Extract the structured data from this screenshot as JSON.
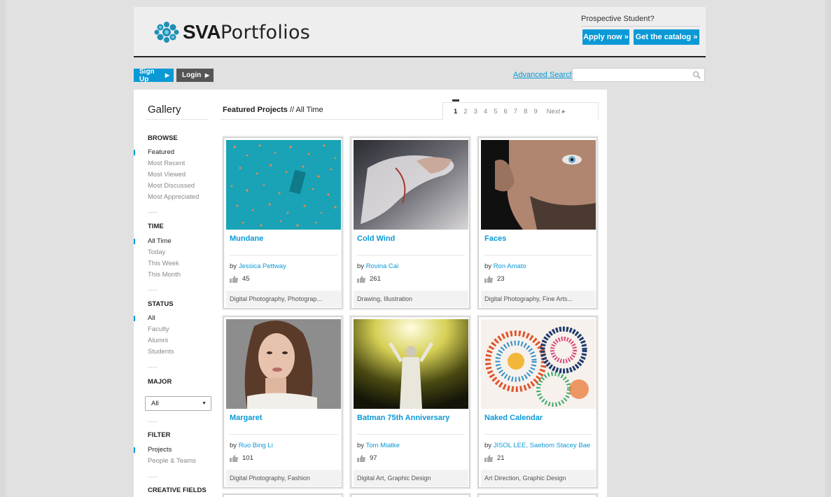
{
  "header": {
    "logo_bold": "SVA",
    "logo_rest": "Portfolios",
    "prospective": "Prospective Student?",
    "apply_label": "Apply now »",
    "catalog_label": "Get the catalog »"
  },
  "subnav": {
    "signup_label": "Sign Up",
    "login_label": "Login",
    "advanced_search_label": "Advanced Search",
    "search_value": ""
  },
  "gallery": {
    "title": "Gallery",
    "featured_label": "Featured Projects",
    "time_label": "// All Time"
  },
  "pager": {
    "pages": [
      "1",
      "2",
      "3",
      "4",
      "5",
      "6",
      "7",
      "8",
      "9"
    ],
    "next_label": "Next ▸"
  },
  "sidebar": {
    "browse_title": "BROWSE",
    "browse_items": [
      "Featured",
      "Most Recent",
      "Most Viewed",
      "Most Discussed",
      "Most Appreciated"
    ],
    "time_title": "TIME",
    "time_items": [
      "All Time",
      "Today",
      "This Week",
      "This Month"
    ],
    "status_title": "STATUS",
    "status_items": [
      "All",
      "Faculty",
      "Alumni",
      "Students"
    ],
    "major_title": "MAJOR",
    "major_value": "All",
    "filter_title": "FILTER",
    "filter_items": [
      "Projects",
      "People & Teams"
    ],
    "creative_title": "CREATIVE FIELDS"
  },
  "cards": [
    {
      "title": "Mundane",
      "by": "by",
      "author": "Jessica Pettway",
      "likes": "45",
      "fields": "Digital Photography, Photograp..."
    },
    {
      "title": "Cold Wind",
      "by": "by",
      "author": "Rovina Cai",
      "likes": "261",
      "fields": "Drawing, Illustration"
    },
    {
      "title": "Faces",
      "by": "by",
      "author": "Ron Amato",
      "likes": "23",
      "fields": "Digital Photography, Fine Arts..."
    },
    {
      "title": "Margaret",
      "by": "by",
      "author": "Ruo Bing Li",
      "likes": "101",
      "fields": "Digital Photography, Fashion"
    },
    {
      "title": "Batman 75th Anniversary",
      "by": "by",
      "author": "Tom Miatke",
      "likes": "97",
      "fields": "Digital Art, Graphic Design"
    },
    {
      "title": "Naked Calendar",
      "by": "by",
      "author": "JISOL LEE, Saebom Stacey Bae",
      "likes": "21",
      "fields": "Art Direction, Graphic Design"
    }
  ],
  "colors": {
    "accent": "#0b99d6",
    "login_bg": "#555555",
    "page_bg": "#e1e1e1"
  }
}
